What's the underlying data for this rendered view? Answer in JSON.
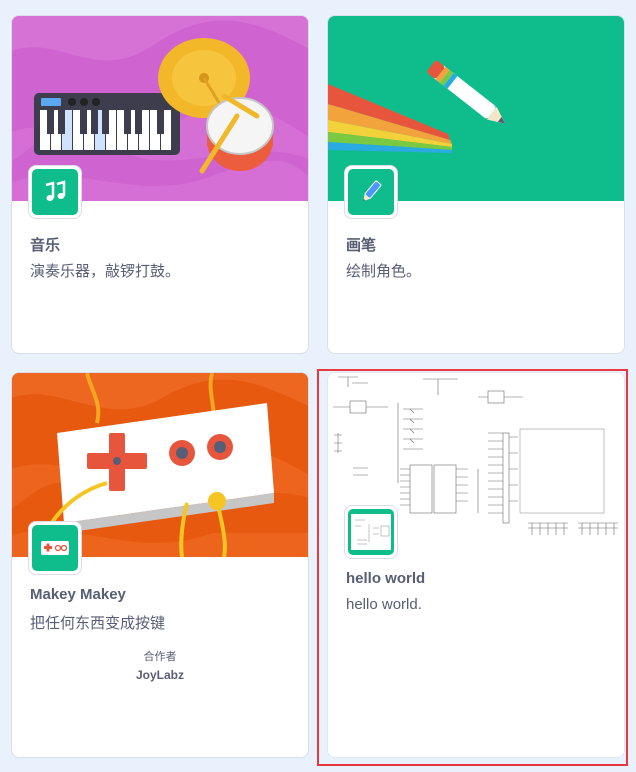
{
  "extensions": [
    {
      "id": "music",
      "title": "音乐",
      "description": "演奏乐器，敲锣打鼓。",
      "icon": "music-notes-icon",
      "banner_color": "#cf63cf"
    },
    {
      "id": "pen",
      "title": "画笔",
      "description": "绘制角色。",
      "icon": "pen-icon",
      "banner_color": "#0fbd8c"
    },
    {
      "id": "makey",
      "title": "Makey Makey",
      "description": "把任何东西变成按键",
      "collaborator_label": "合作者",
      "collaborator_name": "JoyLabz",
      "icon": "makey-board-icon",
      "banner_color": "#e6590f"
    },
    {
      "id": "hello",
      "title": "hello world",
      "description": "hello world.",
      "icon": "schematic-thumbnail-icon",
      "banner_color": "#ffffff"
    }
  ],
  "colors": {
    "page_background": "#e9f1fc",
    "text": "#575e75",
    "icon_green": "#0fbd8c",
    "selection": "#e8383d"
  }
}
